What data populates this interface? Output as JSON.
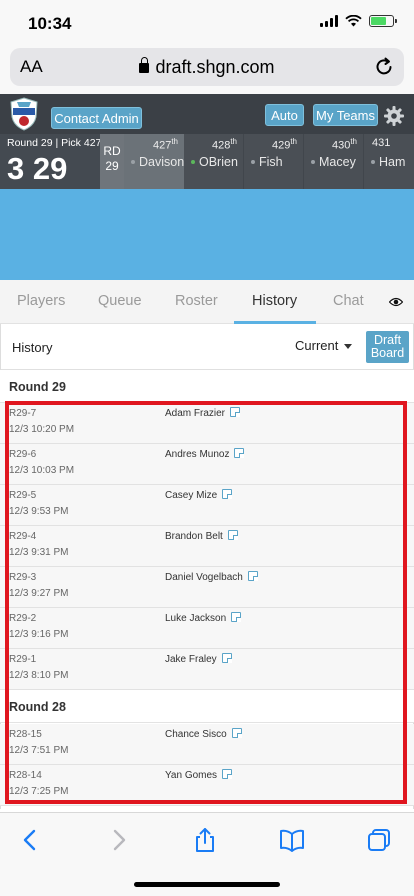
{
  "status_bar": {
    "time": "10:34"
  },
  "browser": {
    "text_size_label": "AA",
    "url": "draft.shgn.com"
  },
  "header": {
    "contact_admin": "Contact Admin",
    "auto": "Auto",
    "my_teams": "My Teams"
  },
  "draft": {
    "current_label": "Round 29 | Pick 427",
    "clock": "3 29",
    "rd_label": "RD",
    "rd_value": "29",
    "picks": [
      {
        "num": "427",
        "suffix": "th",
        "name": "Davison",
        "status": "gray"
      },
      {
        "num": "428",
        "suffix": "th",
        "name": "OBrien",
        "status": "green"
      },
      {
        "num": "429",
        "suffix": "th",
        "name": "Fish",
        "status": "gray"
      },
      {
        "num": "430",
        "suffix": "th",
        "name": "Macey",
        "status": "gray"
      },
      {
        "num": "431",
        "suffix": "",
        "name": "Ham",
        "status": "gray"
      }
    ]
  },
  "tabs": {
    "players": "Players",
    "queue": "Queue",
    "roster": "Roster",
    "history": "History",
    "chat": "Chat",
    "active": "History"
  },
  "history": {
    "title": "History",
    "filter": "Current",
    "draft_board_line1": "Draft",
    "draft_board_line2": "Board",
    "rounds": [
      {
        "label": "Round 29",
        "picks": [
          {
            "pick": "R29-7",
            "time": "12/3 10:20 PM",
            "player": "Adam Frazier"
          },
          {
            "pick": "R29-6",
            "time": "12/3 10:03 PM",
            "player": "Andres Munoz"
          },
          {
            "pick": "R29-5",
            "time": "12/3 9:53 PM",
            "player": "Casey Mize"
          },
          {
            "pick": "R29-4",
            "time": "12/3 9:31 PM",
            "player": "Brandon Belt"
          },
          {
            "pick": "R29-3",
            "time": "12/3 9:27 PM",
            "player": "Daniel Vogelbach"
          },
          {
            "pick": "R29-2",
            "time": "12/3 9:16 PM",
            "player": "Luke Jackson"
          },
          {
            "pick": "R29-1",
            "time": "12/3 8:10 PM",
            "player": "Jake Fraley"
          }
        ]
      },
      {
        "label": "Round 28",
        "picks": [
          {
            "pick": "R28-15",
            "time": "12/3 7:51 PM",
            "player": "Chance Sisco"
          },
          {
            "pick": "R28-14",
            "time": "12/3 7:25 PM",
            "player": "Yan Gomes"
          }
        ]
      }
    ]
  },
  "colors": {
    "accent": "#5aa4c8",
    "banner": "#5ab1e3",
    "highlight_frame": "#e0161f",
    "header_bg": "#3b4046"
  }
}
